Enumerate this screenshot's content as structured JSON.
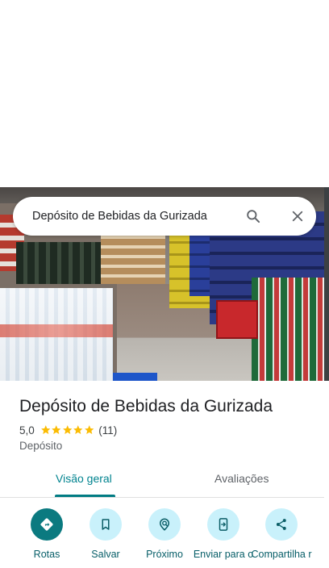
{
  "search": {
    "query": "Depósito de Bebidas da Gurizada",
    "search_icon": "search-icon",
    "close_icon": "close-icon"
  },
  "hero": {
    "photo_icon": "place-photo"
  },
  "place": {
    "name": "Depósito de Bebidas da Gurizada",
    "rating": "5,0",
    "stars": 5,
    "review_count": "(11)",
    "category": "Depósito"
  },
  "tabs": [
    {
      "label": "Visão geral",
      "active": true
    },
    {
      "label": "Avaliações",
      "active": false
    }
  ],
  "actions": [
    {
      "label": "Rotas",
      "icon": "directions-icon"
    },
    {
      "label": "Salvar",
      "icon": "bookmark-icon"
    },
    {
      "label": "Próximo",
      "icon": "nearby-icon"
    },
    {
      "label": "Enviar para o",
      "icon": "send-to-phone-icon"
    },
    {
      "label": "Compartilha r",
      "icon": "share-icon"
    }
  ],
  "colors": {
    "accent": "#0b7a80",
    "action_bg": "#c9f1fb",
    "star": "#fbbc04"
  }
}
